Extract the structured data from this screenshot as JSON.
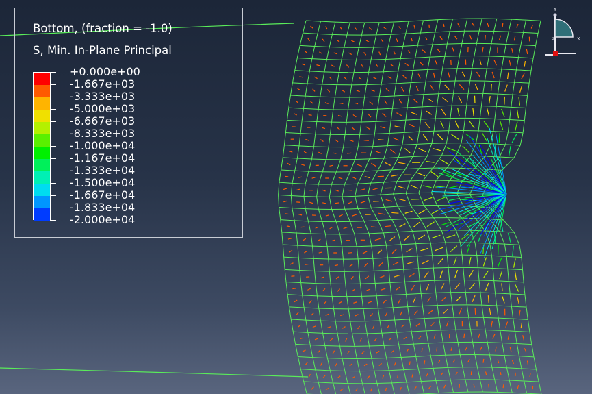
{
  "legend": {
    "title_line1": "Bottom, (fraction = -1.0)",
    "title_line2": "S, Min. In-Plane Principal",
    "levels": [
      {
        "label": "+0.000e+00",
        "color": "#ff0000"
      },
      {
        "label": "-1.667e+03",
        "color": "#ff5a00"
      },
      {
        "label": "-3.333e+03",
        "color": "#ffb400"
      },
      {
        "label": "-5.000e+03",
        "color": "#f0e000"
      },
      {
        "label": "-6.667e+03",
        "color": "#b4f000"
      },
      {
        "label": "-8.333e+03",
        "color": "#5af000"
      },
      {
        "label": "-1.000e+04",
        "color": "#00f000"
      },
      {
        "label": "-1.167e+04",
        "color": "#00f05a"
      },
      {
        "label": "-1.333e+04",
        "color": "#00f0b4"
      },
      {
        "label": "-1.500e+04",
        "color": "#00dcf0"
      },
      {
        "label": "-1.667e+04",
        "color": "#0096ff"
      },
      {
        "label": "-1.833e+04",
        "color": "#003cff"
      },
      {
        "label": "-2.000e+04",
        "color": "#0000ff"
      }
    ]
  },
  "triad": {
    "x_label": "X",
    "y_label": "Y",
    "z_label": "Z"
  },
  "colors": {
    "mesh": "#5aec5a",
    "background_top": "#1c2638",
    "background_bottom": "#59657e"
  }
}
